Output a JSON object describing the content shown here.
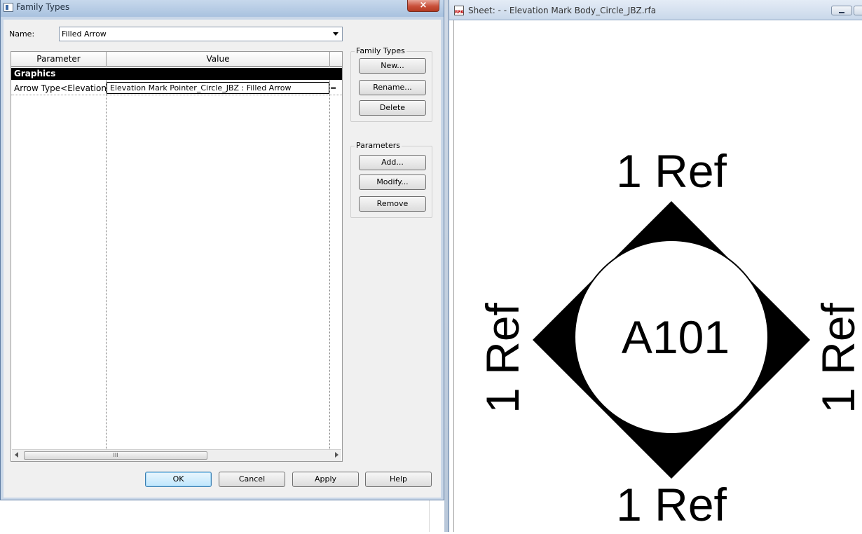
{
  "dialog": {
    "title": "Family Types",
    "close_glyph": "×",
    "name_label": "Name:",
    "name_value": "Filled Arrow",
    "table": {
      "columns": [
        "Parameter",
        "Value"
      ],
      "group_header": "Graphics",
      "rows": [
        {
          "parameter": "Arrow Type<Elevation",
          "value": "Elevation Mark Pointer_Circle_JBZ : Filled Arrow",
          "formula": "="
        }
      ],
      "scroll_thumb_glyph": "III"
    },
    "family_types_group": {
      "label": "Family Types",
      "new": "New...",
      "rename": "Rename...",
      "delete": "Delete"
    },
    "parameters_group": {
      "label": "Parameters",
      "add": "Add...",
      "modify": "Modify...",
      "remove": "Remove"
    },
    "footer": {
      "ok": "OK",
      "cancel": "Cancel",
      "apply": "Apply",
      "help": "Help"
    }
  },
  "sheet": {
    "title": "Sheet:  -  - Elevation Mark Body_Circle_JBZ.rfa",
    "icon_label": "RFA",
    "drawing": {
      "center_label": "A101",
      "top_label": "1 Ref",
      "bottom_label": "1 Ref",
      "left_label": "1 Ref",
      "right_label": "1 Ref"
    }
  }
}
